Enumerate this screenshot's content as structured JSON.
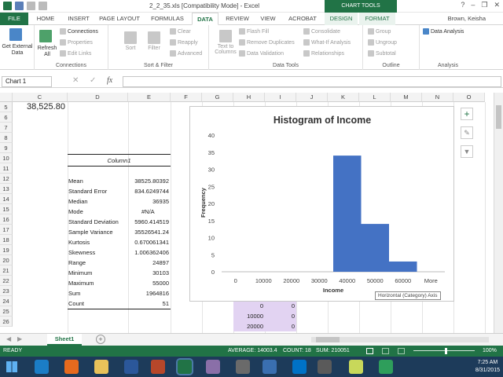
{
  "window": {
    "title": "2_2_35.xls [Compatibility Mode] - Excel",
    "chart_tools": "CHART TOOLS",
    "user": "Brown, Keisha"
  },
  "tabs": [
    "FILE",
    "HOME",
    "INSERT",
    "PAGE LAYOUT",
    "FORMULAS",
    "DATA",
    "REVIEW",
    "VIEW",
    "ACROBAT",
    "DESIGN",
    "FORMAT"
  ],
  "ribbon": {
    "get_external": "Get External Data",
    "refresh": "Refresh All",
    "connections": "Connections",
    "properties": "Properties",
    "edit_links": "Edit Links",
    "grp_connections": "Connections",
    "sort": "Sort",
    "filter": "Filter",
    "clear": "Clear",
    "reapply": "Reapply",
    "advanced": "Advanced",
    "grp_sortfilter": "Sort & Filter",
    "text_to_columns": "Text to Columns",
    "flash_fill": "Flash Fill",
    "remove_duplicates": "Remove Duplicates",
    "data_validation": "Data Validation",
    "consolidate": "Consolidate",
    "what_if": "What-If Analysis",
    "relationships": "Relationships",
    "grp_datatools": "Data Tools",
    "group": "Group",
    "ungroup": "Ungroup",
    "subtotal": "Subtotal",
    "grp_outline": "Outline",
    "data_analysis": "Data Analysis",
    "grp_analysis": "Analysis"
  },
  "formula_bar": {
    "name_box": "Chart 1",
    "fx": "fx",
    "value": ""
  },
  "columns": [
    "C",
    "D",
    "E",
    "F",
    "G",
    "H",
    "I",
    "J",
    "K",
    "L",
    "M",
    "N",
    "O"
  ],
  "rows": [
    "5",
    "6",
    "7",
    "8",
    "9",
    "10",
    "11",
    "12",
    "13",
    "14",
    "15",
    "16",
    "17",
    "18",
    "19",
    "20",
    "21",
    "22",
    "23",
    "24",
    "25",
    "26"
  ],
  "cells": {
    "c5": "38,525.80",
    "col_header": "Column1",
    "stats": [
      {
        "label": "Mean",
        "value": "38525.80392"
      },
      {
        "label": "Standard Error",
        "value": "834.6249744"
      },
      {
        "label": "Median",
        "value": "36935"
      },
      {
        "label": "Mode",
        "value": "#N/A"
      },
      {
        "label": "Standard Deviation",
        "value": "5960.414519"
      },
      {
        "label": "Sample Variance",
        "value": "35526541.24"
      },
      {
        "label": "Kurtosis",
        "value": "0.670061341"
      },
      {
        "label": "Skewness",
        "value": "1.006362406"
      },
      {
        "label": "Range",
        "value": "24897"
      },
      {
        "label": "Minimum",
        "value": "30103"
      },
      {
        "label": "Maximum",
        "value": "55000"
      },
      {
        "label": "Sum",
        "value": "1964816"
      },
      {
        "label": "Count",
        "value": "51"
      }
    ],
    "bins": [
      {
        "h": "0",
        "i": "0"
      },
      {
        "h": "10000",
        "i": "0"
      },
      {
        "h": "20000",
        "i": "0"
      }
    ]
  },
  "chart_data": {
    "type": "bar",
    "title": "Histogram of Income",
    "xlabel": "Income",
    "ylabel": "Frequency",
    "categories": [
      "0",
      "10000",
      "20000",
      "30000",
      "40000",
      "50000",
      "60000",
      "More"
    ],
    "values": [
      0,
      0,
      0,
      0,
      34,
      14,
      3,
      0
    ],
    "ylim": [
      0,
      40
    ],
    "yticks": [
      "0",
      "5",
      "10",
      "15",
      "20",
      "25",
      "30",
      "35",
      "40"
    ],
    "bar_color": "#4472c4",
    "grid": false,
    "legend": "none"
  },
  "tooltip": "Horizontal (Category) Axis",
  "sheet": {
    "tab": "Sheet1",
    "add": "+"
  },
  "status": {
    "ready": "READY",
    "average": "AVERAGE: 14003.4",
    "count": "COUNT: 18",
    "sum": "SUM: 210051",
    "zoom": "100%"
  },
  "clock": {
    "time": "7:25 AM",
    "date": "8/31/2015"
  },
  "colors": {
    "excel_green": "#217346",
    "taskbar": "#1d3b5a",
    "bin_fill": "#e2d3f2"
  }
}
